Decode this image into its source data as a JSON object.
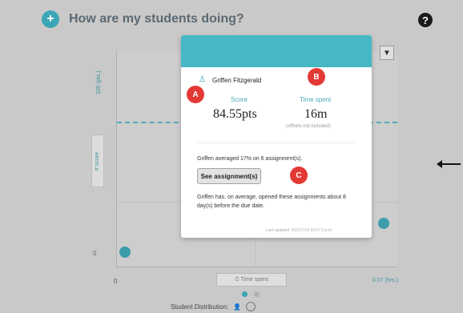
{
  "header": {
    "title": "How are my students doing?",
    "plus_icon": "plus-icon",
    "help_icon": "help-icon"
  },
  "chart": {
    "y_axis_label": "# score",
    "y_top_label": "100 (pts.)",
    "y_bottom_tick": "0",
    "x_start_tick": "0",
    "x_end_label": "0.07 (hrs.)",
    "x_axis_button": "⏱ Time spent",
    "filter_icon": "filter-icon"
  },
  "popup": {
    "student_name": "Griffen Fitzgerald",
    "score_label": "Score",
    "score_value": "84.55pts",
    "time_label": "Time spent",
    "time_value": "16m",
    "time_note": "(offsets not included)",
    "average_text": "Griffen averaged 17% on 6 assignment(s).",
    "button_label": "See assignment(s)",
    "opened_text": "Griffen has, on average, opened these assignments about 8 day(s) before the due date.",
    "updated_text": "Last updated: 2021/7/14 10:17:3 p.m."
  },
  "markers": {
    "a": "A",
    "b": "B",
    "c": "C"
  },
  "footer": {
    "distribution_label": "Student Distribution:"
  },
  "arrow_icon": "left-arrow-icon",
  "colors": {
    "accent": "#46b7c5",
    "marker": "#e33935",
    "background": "#c9c9c9"
  }
}
